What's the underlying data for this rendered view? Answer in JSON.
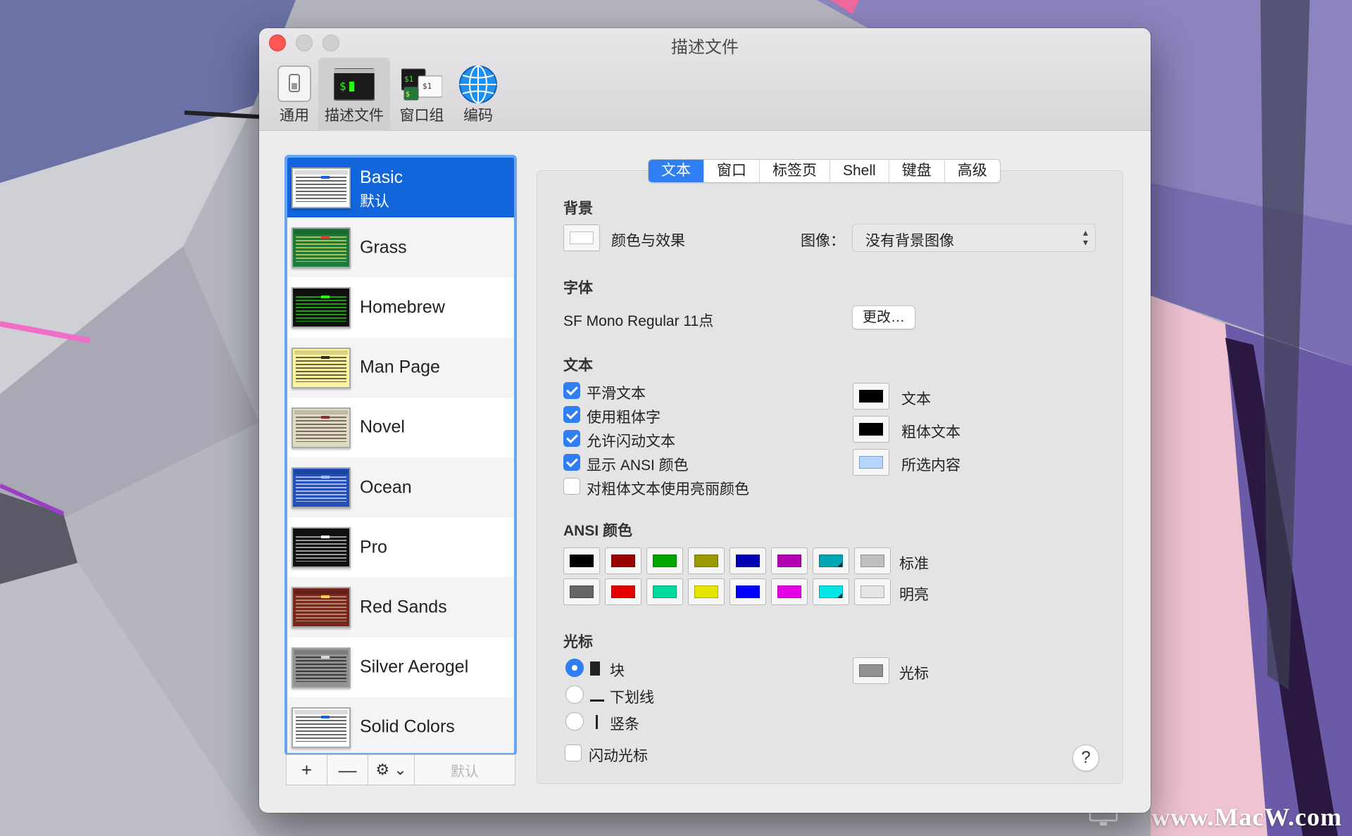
{
  "window": {
    "title": "描述文件"
  },
  "toolbar": {
    "items": [
      {
        "label": "通用",
        "icon": "switch-icon"
      },
      {
        "label": "描述文件",
        "icon": "terminal-icon",
        "selected": true
      },
      {
        "label": "窗口组",
        "icon": "window-group-icon"
      },
      {
        "label": "编码",
        "icon": "globe-icon"
      }
    ]
  },
  "profiles": {
    "items": [
      {
        "name": "Basic",
        "sub": "默认",
        "selected": true,
        "bg": "#ffffff",
        "fg": "#000000",
        "accent": "#1365dc"
      },
      {
        "name": "Grass",
        "bg": "#1f7a3a",
        "fg": "#fff36e",
        "accent": "#e03a2e"
      },
      {
        "name": "Homebrew",
        "bg": "#111111",
        "fg": "#28fe14",
        "accent": "#28fe14"
      },
      {
        "name": "Man Page",
        "bg": "#fef49c",
        "fg": "#000000",
        "accent": "#2d2d2d"
      },
      {
        "name": "Novel",
        "bg": "#dfdbc3",
        "fg": "#3b2322",
        "accent": "#8b2f2f"
      },
      {
        "name": "Ocean",
        "bg": "#224fbc",
        "fg": "#ffffff",
        "accent": "#9ec7ff"
      },
      {
        "name": "Pro",
        "bg": "#111111",
        "fg": "#f2f2f2",
        "accent": "#f2f2f2"
      },
      {
        "name": "Red Sands",
        "bg": "#7a251e",
        "fg": "#d7c9a7",
        "accent": "#ffd24a"
      },
      {
        "name": "Silver Aerogel",
        "bg": "#929292",
        "fg": "#000000",
        "accent": "#dadada"
      },
      {
        "name": "Solid Colors",
        "bg": "#ffffff",
        "fg": "#000000",
        "accent": "#1365dc"
      }
    ],
    "controls": {
      "add": "+",
      "remove": "—",
      "gear": "⚙ ⌄",
      "default": "默认"
    }
  },
  "tabs": [
    {
      "label": "文本",
      "active": true
    },
    {
      "label": "窗口"
    },
    {
      "label": "标签页"
    },
    {
      "label": "Shell"
    },
    {
      "label": "键盘"
    },
    {
      "label": "高级"
    }
  ],
  "background": {
    "heading": "背景",
    "color_effects": "颜色与效果",
    "image_label": "图像：",
    "image_value": "没有背景图像"
  },
  "font": {
    "heading": "字体",
    "value": "SF Mono Regular 11点",
    "change_button": "更改…"
  },
  "text": {
    "heading": "文本",
    "options": [
      {
        "label": "平滑文本",
        "checked": true
      },
      {
        "label": "使用粗体字",
        "checked": true
      },
      {
        "label": "允许闪动文本",
        "checked": true
      },
      {
        "label": "显示 ANSI 颜色",
        "checked": true
      },
      {
        "label": "对粗体文本使用亮丽颜色",
        "checked": false
      }
    ],
    "colors": [
      {
        "label": "文本",
        "color": "#000000"
      },
      {
        "label": "粗体文本",
        "color": "#000000"
      },
      {
        "label": "所选内容",
        "color": "#b4d5fe"
      }
    ]
  },
  "ansi": {
    "heading": "ANSI 颜色",
    "normal_label": "标准",
    "bright_label": "明亮",
    "normal": [
      "#000000",
      "#990000",
      "#00a600",
      "#999900",
      "#0000b2",
      "#b200b2",
      "#00a6b2",
      "#bfbfbf"
    ],
    "bright": [
      "#666666",
      "#e50000",
      "#00d9a0",
      "#e5e500",
      "#0000ff",
      "#e500e5",
      "#00e5e5",
      "#e5e5e5"
    ]
  },
  "cursor": {
    "heading": "光标",
    "styles": [
      {
        "label": "块",
        "selected": true
      },
      {
        "label": "下划线",
        "selected": false
      },
      {
        "label": "竖条",
        "selected": false
      }
    ],
    "blink": {
      "label": "闪动光标",
      "checked": false
    },
    "color_label": "光标",
    "color": "#929292"
  },
  "help_button": "?",
  "watermark": "www.MacW.com"
}
